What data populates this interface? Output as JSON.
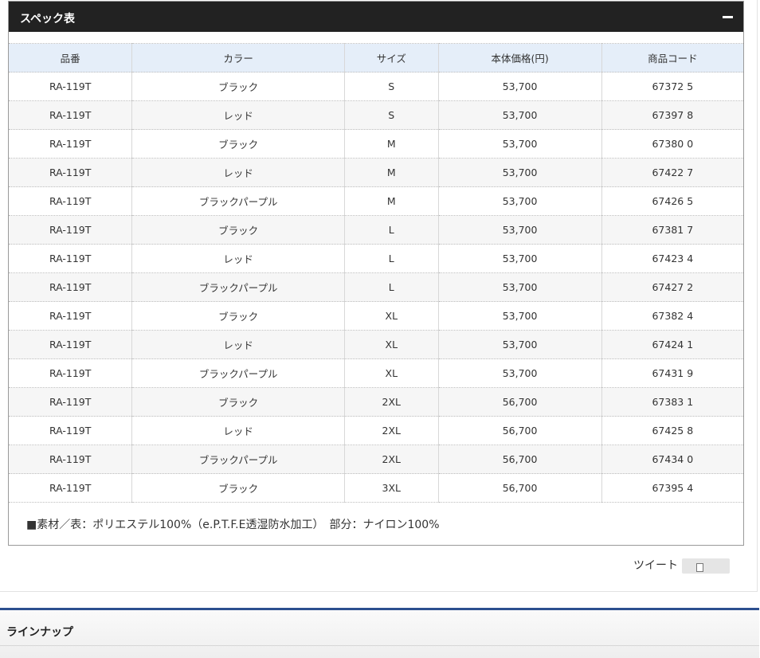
{
  "spec_section": {
    "title": "スペック表",
    "columns": [
      "品番",
      "カラー",
      "サイズ",
      "本体価格(円)",
      "商品コード"
    ],
    "rows": [
      [
        "RA-119T",
        "ブラック",
        "S",
        "53,700",
        "67372 5"
      ],
      [
        "RA-119T",
        "レッド",
        "S",
        "53,700",
        "67397 8"
      ],
      [
        "RA-119T",
        "ブラック",
        "M",
        "53,700",
        "67380 0"
      ],
      [
        "RA-119T",
        "レッド",
        "M",
        "53,700",
        "67422 7"
      ],
      [
        "RA-119T",
        "ブラックパープル",
        "M",
        "53,700",
        "67426 5"
      ],
      [
        "RA-119T",
        "ブラック",
        "L",
        "53,700",
        "67381 7"
      ],
      [
        "RA-119T",
        "レッド",
        "L",
        "53,700",
        "67423 4"
      ],
      [
        "RA-119T",
        "ブラックパープル",
        "L",
        "53,700",
        "67427 2"
      ],
      [
        "RA-119T",
        "ブラック",
        "XL",
        "53,700",
        "67382 4"
      ],
      [
        "RA-119T",
        "レッド",
        "XL",
        "53,700",
        "67424 1"
      ],
      [
        "RA-119T",
        "ブラックパープル",
        "XL",
        "53,700",
        "67431 9"
      ],
      [
        "RA-119T",
        "ブラック",
        "2XL",
        "56,700",
        "67383 1"
      ],
      [
        "RA-119T",
        "レッド",
        "2XL",
        "56,700",
        "67425 8"
      ],
      [
        "RA-119T",
        "ブラックパープル",
        "2XL",
        "56,700",
        "67434 0"
      ],
      [
        "RA-119T",
        "ブラック",
        "3XL",
        "56,700",
        "67395 4"
      ]
    ],
    "material_note": "■素材／表：ポリエステル100%（e.P.T.F.E透湿防水加工）　部分：ナイロン100%"
  },
  "share": {
    "tweet_label": "ツイート"
  },
  "lineup_section": {
    "title": "ラインナップ"
  },
  "colors": {
    "header_bg": "#222222",
    "table_header_bg": "#e5eef9",
    "section_border": "#2c4f8f"
  }
}
